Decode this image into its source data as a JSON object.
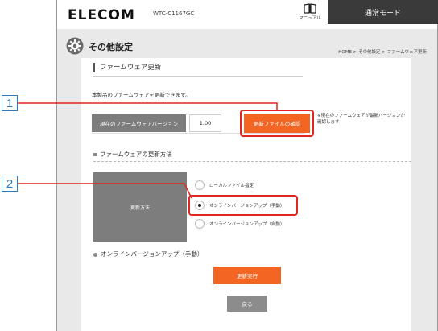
{
  "header": {
    "logo": "ELECOM",
    "model": "WTC-C1167GC",
    "manual_label": "マニュアル",
    "mode_button": "通常モード"
  },
  "page": {
    "title": "その他設定",
    "breadcrumb": "HOME > その他設定 > ファームウェア更新"
  },
  "firmware": {
    "section_title": "ファームウェア更新",
    "description": "本製品のファームウェアを更新できます。",
    "version_label": "現在のファームウェアバージョン",
    "version_value": "1.00",
    "check_button": "更新ファイルの確認",
    "note": "※現在のファームウェアが最新バージョンか確認します"
  },
  "update_method": {
    "section_title": "ファームウェアの更新方法",
    "label": "更新方法",
    "options": [
      {
        "label": "ローカルファイル指定",
        "selected": false
      },
      {
        "label": "オンラインバージョンアップ（手動）",
        "selected": true
      },
      {
        "label": "オンラインバージョンアップ（自動）",
        "selected": false
      }
    ]
  },
  "online": {
    "section_title": "オンラインバージョンアップ（手動）",
    "execute_button": "更新実行",
    "back_button": "戻る"
  },
  "callouts": [
    "1",
    "2"
  ],
  "colors": {
    "accent_orange": "#f26522",
    "highlight_red": "#e0271f",
    "callout_blue": "#2b7bbf",
    "label_gray": "#7d7d7d",
    "header_dark": "#3a3a3a"
  }
}
